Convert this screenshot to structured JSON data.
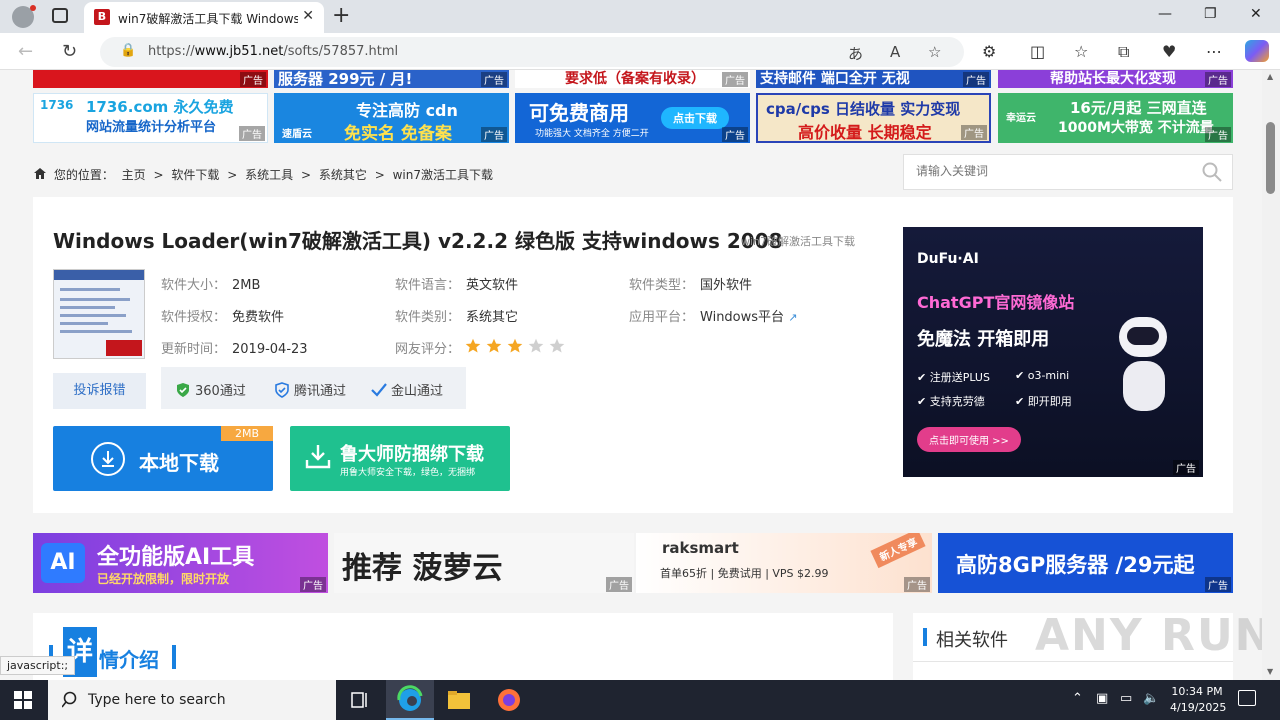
{
  "browser": {
    "tab_title": "win7破解激活工具下载 Windows",
    "url_prefix": "https://",
    "url_host": "www.jb51.net",
    "url_path": "/softs/57857.html",
    "favicon_letter": "B"
  },
  "ads_top_row1": [
    {
      "text": "",
      "color": "#d9151d"
    },
    {
      "text": "服务器 299元 / 月!",
      "color": "#2a62c9"
    },
    {
      "text": "要求低（备案有收录）",
      "color": "#c4161c"
    },
    {
      "text": "支持邮件 端口全开 无视",
      "color": "#1f54c0"
    },
    {
      "text": "帮助站长最大化变现",
      "color": "#8b3fd9"
    }
  ],
  "ads_top_row2": [
    {
      "text": "1736.com 永久免费",
      "sub": "网站流量统计分析平台",
      "color": "#1aa4e0"
    },
    {
      "text": "专注高防 cdn",
      "sub": "免实名 免备案",
      "brand": "速盾云",
      "color": "#1a86e0"
    },
    {
      "text": "可免费商用",
      "sub": "功能强大 文档齐全 方便二开",
      "button": "点击下载",
      "color": "#1366d6"
    },
    {
      "text": "cpa/cps 日结收量 实力变现",
      "sub": "高价收量 长期稳定",
      "color": "#e88324"
    },
    {
      "text": "16元/月起 三网直连",
      "sub": "1000M大带宽 不计流量",
      "brand": "幸运云",
      "color": "#3fb56b"
    }
  ],
  "ad_tag": "广告",
  "breadcrumb": {
    "prefix": "您的位置：",
    "items": [
      "主页",
      "软件下载",
      "系统工具",
      "系统其它",
      "win7激活工具下载"
    ],
    "sep": ">"
  },
  "search": {
    "placeholder": "请输入关键词"
  },
  "software": {
    "title": "Windows Loader(win7破解激活工具) v2.2.2 绿色版 支持windows 2008",
    "subtitle": "win7破解激活工具下载",
    "fields": [
      {
        "label": "软件大小：",
        "value": "2MB"
      },
      {
        "label": "软件语言：",
        "value": "英文软件"
      },
      {
        "label": "软件类型：",
        "value": "国外软件"
      },
      {
        "label": "软件授权：",
        "value": "免费软件"
      },
      {
        "label": "软件类别：",
        "value": "系统其它"
      },
      {
        "label": "应用平台：",
        "value": "Windows平台"
      },
      {
        "label": "更新时间：",
        "value": "2019-04-23"
      },
      {
        "label": "网友评分：",
        "value": ""
      }
    ],
    "rating": 3,
    "rating_max": 5,
    "report": "投诉报错",
    "checks": [
      "360通过",
      "腾讯通过",
      "金山通过"
    ],
    "download_local": "本地下载",
    "download_size": "2MB",
    "download_ludashi": "鲁大师防捆绑下载",
    "download_ludashi_sub": "用鲁大师安全下载，绿色，无捆绑"
  },
  "side_ad": {
    "brand": "DuFu·AI",
    "headline": "ChatGPT官网镜像站",
    "sub": "免魔法 开箱即用",
    "features": [
      "注册送PLUS",
      "o3-mini",
      "支持克劳德",
      "即开即用"
    ],
    "cta": "点击即可使用 >>"
  },
  "ads_mid": [
    {
      "text": "全功能版AI工具",
      "sub": "已经开放限制，限时开放",
      "color": "#7b3fe0"
    },
    {
      "text": "推荐 菠萝云",
      "color": "#f5f5f5"
    },
    {
      "text": "raksmart",
      "sub": "首单65折 | 免费试用 | VPS $2.99",
      "corner": "新人专享",
      "color": "#fde9dc"
    },
    {
      "text": "高防8GP服务器 /29元起",
      "color": "#1652d6"
    }
  ],
  "detail": {
    "big_char": "详",
    "rest": "情介绍"
  },
  "related": {
    "title": "相关软件"
  },
  "watermark": "ANY RUN",
  "status_link": "javascript:;",
  "taskbar": {
    "search_placeholder": "Type here to search",
    "time": "10:34 PM",
    "date": "4/19/2025"
  }
}
